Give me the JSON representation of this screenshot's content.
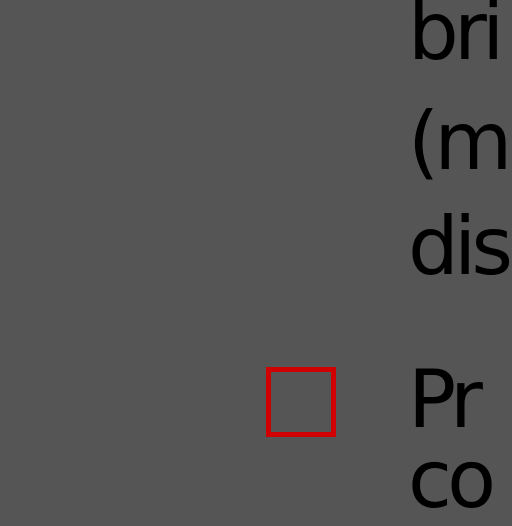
{
  "option_1": {
    "text_lines": [
      "bri",
      "(m",
      "dis"
    ]
  },
  "option_2": {
    "checked": false,
    "checkbox_color": "#d00000",
    "text_lines": [
      "Pr",
      "co"
    ]
  },
  "colors": {
    "background": "#555555",
    "text": "#000000"
  }
}
